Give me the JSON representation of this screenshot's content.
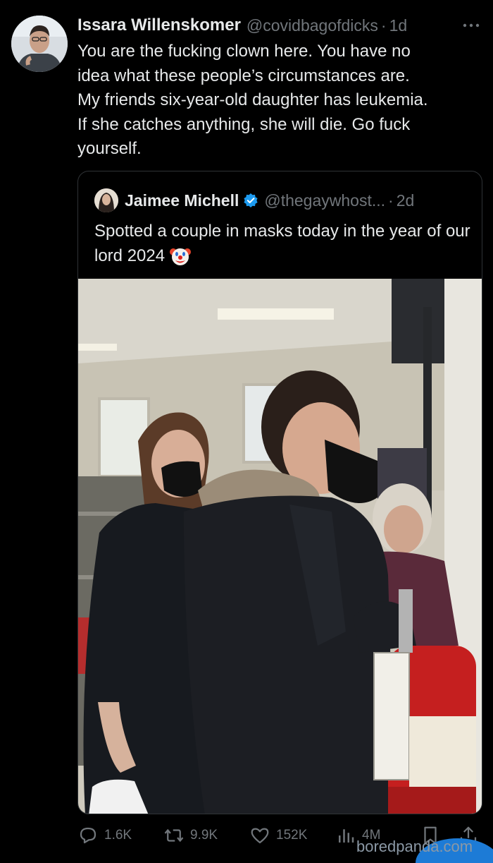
{
  "tweet": {
    "author_name": "Issara Willenskomer",
    "author_handle": "@covidbagofdicks",
    "separator": "·",
    "time": "1d",
    "text": "You are the fucking clown here. You have no\nidea what these people’s circumstances are.\nMy friends six-year-old daughter has leukemia.\nIf she catches anything, she will die. Go fuck\nyourself."
  },
  "quote": {
    "author_name": "Jaimee Michell",
    "author_handle": "@thegaywhost...",
    "separator": "·",
    "time": "2d",
    "text": "Spotted a couple in masks today in the year of our lord 2024"
  },
  "actions": {
    "replies": "1.6K",
    "retweets": "9.9K",
    "likes": "152K",
    "views": "4M"
  },
  "watermark": "boredpanda.com",
  "colors": {
    "background": "#000000",
    "text": "#e7e9ea",
    "muted": "#71767b",
    "verified": "#1d9bf0"
  }
}
